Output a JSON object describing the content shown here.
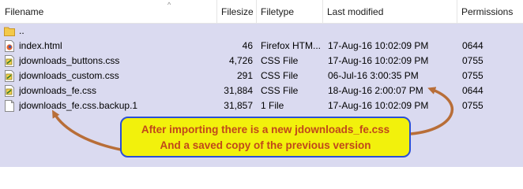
{
  "columns": {
    "filename": "Filename",
    "filesize": "Filesize",
    "filetype": "Filetype",
    "last_modified": "Last modified",
    "permissions": "Permissions"
  },
  "parent_dir": "..",
  "files": [
    {
      "name": "index.html",
      "size": "46",
      "type": "Firefox HTM...",
      "modified": "17-Aug-16 10:02:09 PM",
      "perm": "0644",
      "icon": "firefox-html-icon"
    },
    {
      "name": "jdownloads_buttons.css",
      "size": "4,726",
      "type": "CSS File",
      "modified": "17-Aug-16 10:02:09 PM",
      "perm": "0755",
      "icon": "css-file-icon"
    },
    {
      "name": "jdownloads_custom.css",
      "size": "291",
      "type": "CSS File",
      "modified": "06-Jul-16 3:00:35 PM",
      "perm": "0755",
      "icon": "css-file-icon"
    },
    {
      "name": "jdownloads_fe.css",
      "size": "31,884",
      "type": "CSS File",
      "modified": "18-Aug-16 2:00:07 PM",
      "perm": "0644",
      "icon": "css-file-icon"
    },
    {
      "name": "jdownloads_fe.css.backup.1",
      "size": "31,857",
      "type": "1 File",
      "modified": "17-Aug-16 10:02:09 PM",
      "perm": "0755",
      "icon": "blank-file-icon"
    }
  ],
  "callout": {
    "line1": "After importing there is a new jdownloads_fe.css",
    "line2": "And a saved copy of the previous version"
  },
  "colors": {
    "list_background": "#dadaf0",
    "callout_fill": "#f2f10c",
    "callout_border": "#2a4fd6",
    "callout_text": "#c0481a",
    "arrow": "#b86e38"
  }
}
